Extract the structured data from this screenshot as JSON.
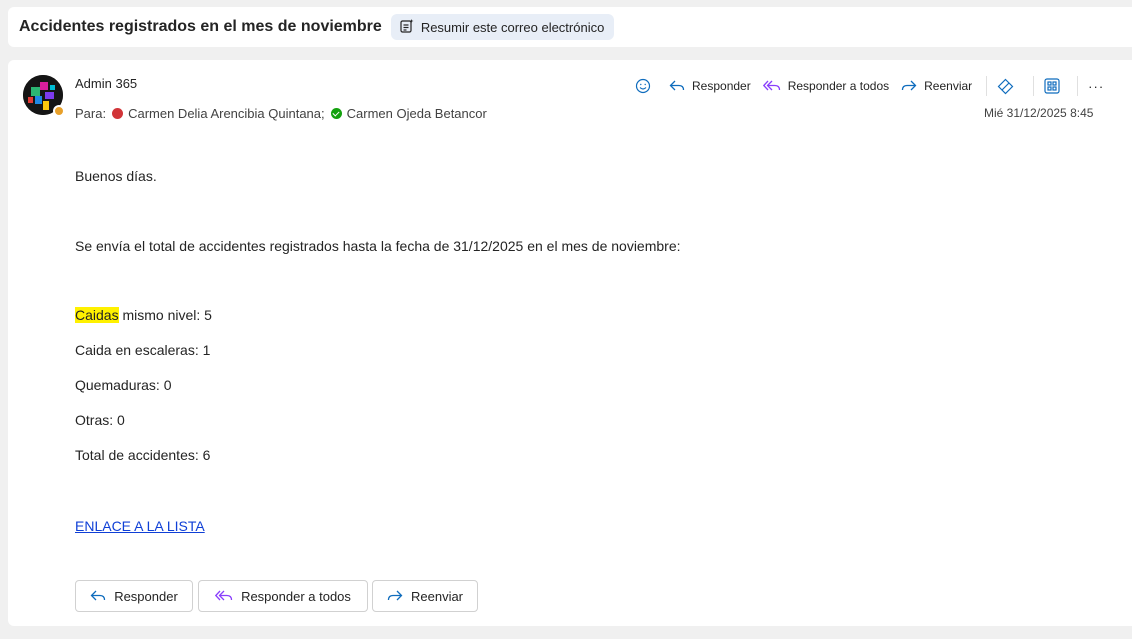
{
  "header": {
    "subject": "Accidentes registrados en el mes de noviembre",
    "summarize_label": "Resumir este correo electrónico"
  },
  "message": {
    "sender": "Admin 365",
    "to_prefix": "Para:",
    "recipients": [
      {
        "name": "Carmen Delia Arencibia Quintana;",
        "status": "busy",
        "status_color": "#d13438"
      },
      {
        "name": "Carmen Ojeda Betancor",
        "status": "available",
        "status_color": "#13a10e"
      }
    ],
    "date": "Mié 31/12/2025 8:45",
    "actions": {
      "reply": "Responder",
      "reply_all": "Responder a todos",
      "forward": "Reenviar",
      "more": "···"
    },
    "body": {
      "greeting": "Buenos días.",
      "intro": "Se envía el total de accidentes registrados hasta la fecha de 31/12/2025 en el mes de noviembre:",
      "line1_highlight": "Caidas",
      "line1_rest": " mismo nivel: 5",
      "line2": "Caida en escaleras: 1",
      "line3": "Quemaduras: 0",
      "line4": "Otras: 0",
      "line5": "Total de accidentes: 6",
      "link": "ENLACE A LA LISTA"
    },
    "bottom_buttons": {
      "reply": "Responder",
      "reply_all": "Responder a todos",
      "forward": "Reenviar"
    }
  },
  "colors": {
    "accent_blue": "#0f6cbd",
    "reply_all_purple": "#8a3ffc",
    "highlight": "#fff100",
    "link": "#0f3fd6"
  }
}
